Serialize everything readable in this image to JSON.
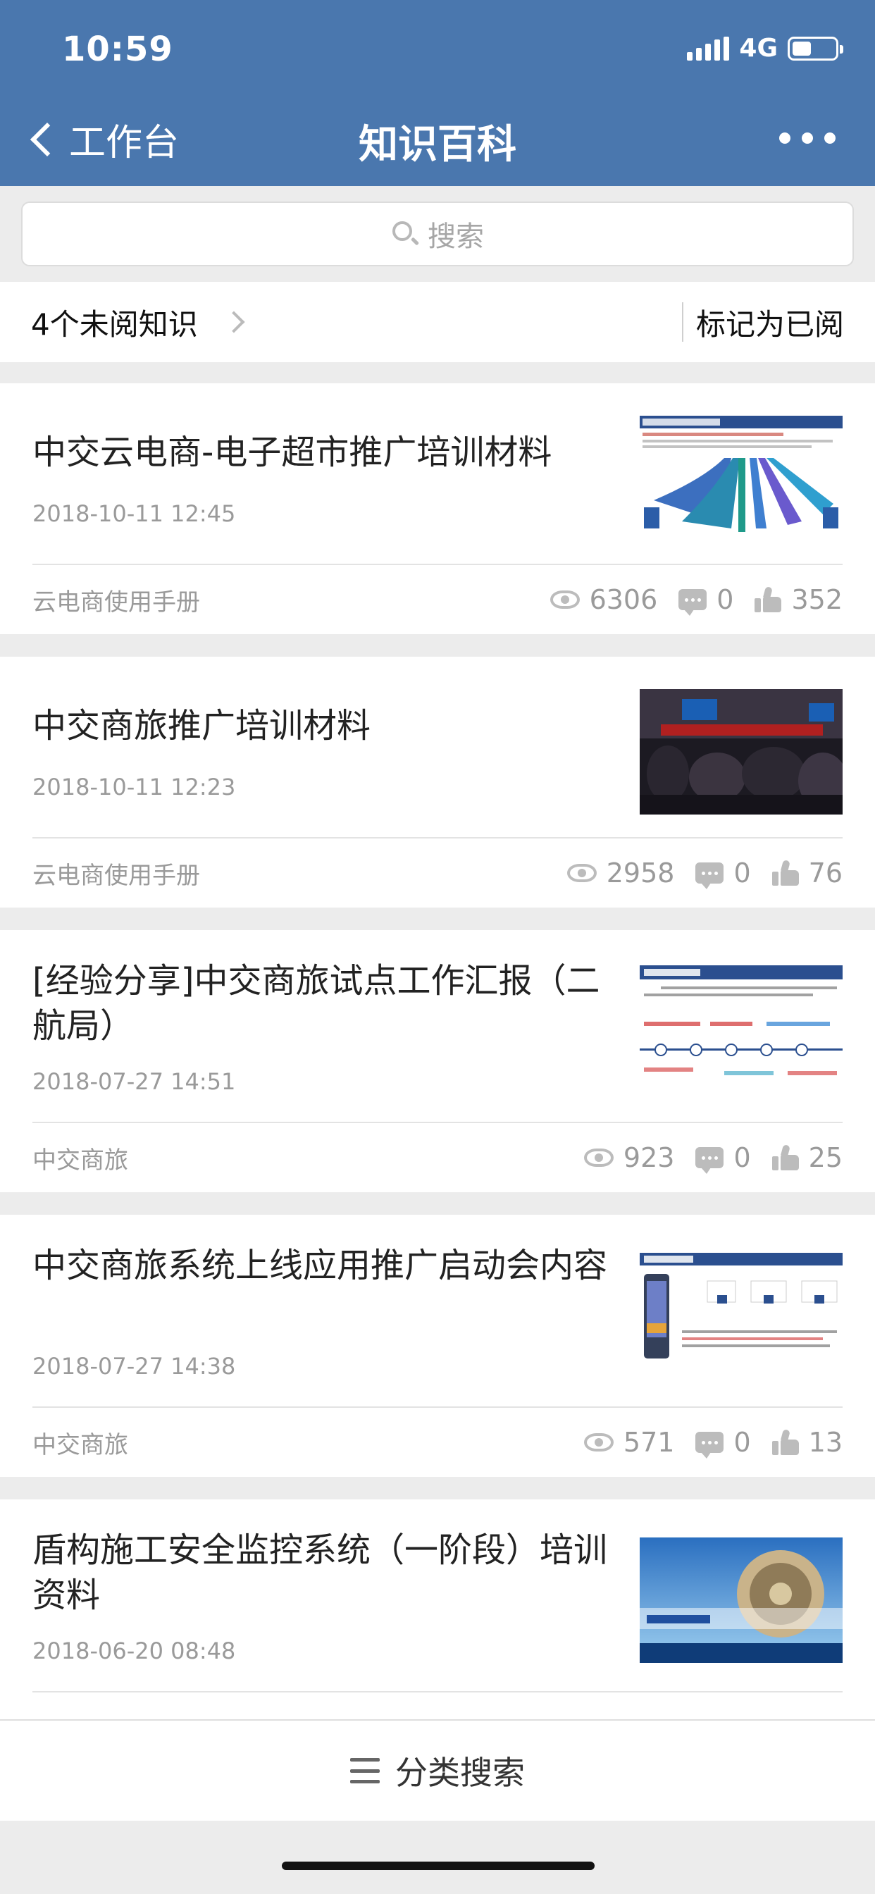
{
  "status": {
    "time": "10:59",
    "network": "4G",
    "battery_level": 0.45
  },
  "nav": {
    "back_label": "工作台",
    "title": "知识百科"
  },
  "search": {
    "placeholder": "搜索"
  },
  "unread": {
    "label": "4个未阅知识",
    "mark_read": "标记为已阅"
  },
  "articles": [
    {
      "title": "中交云电商-电子超市推广培训材料",
      "date": "2018-10-11 12:45",
      "category": "云电商使用手册",
      "views": "6306",
      "comments": "0",
      "likes": "352"
    },
    {
      "title": "中交商旅推广培训材料",
      "date": "2018-10-11 12:23",
      "category": "云电商使用手册",
      "views": "2958",
      "comments": "0",
      "likes": "76"
    },
    {
      "title": "[经验分享]中交商旅试点工作汇报（二航局）",
      "date": "2018-07-27 14:51",
      "category": "中交商旅",
      "views": "923",
      "comments": "0",
      "likes": "25"
    },
    {
      "title": "中交商旅系统上线应用推广启动会内容",
      "date": "2018-07-27 14:38",
      "category": "中交商旅",
      "views": "571",
      "comments": "0",
      "likes": "13"
    },
    {
      "title": "盾构施工安全监控系统（一阶段）培训资料",
      "date": "2018-06-20 08:48",
      "category": "",
      "views": "",
      "comments": "",
      "likes": ""
    }
  ],
  "bottom": {
    "label": "分类搜索"
  },
  "colors": {
    "header": "#4a77ae",
    "background": "#ececec",
    "muted": "#9a9a9a"
  }
}
